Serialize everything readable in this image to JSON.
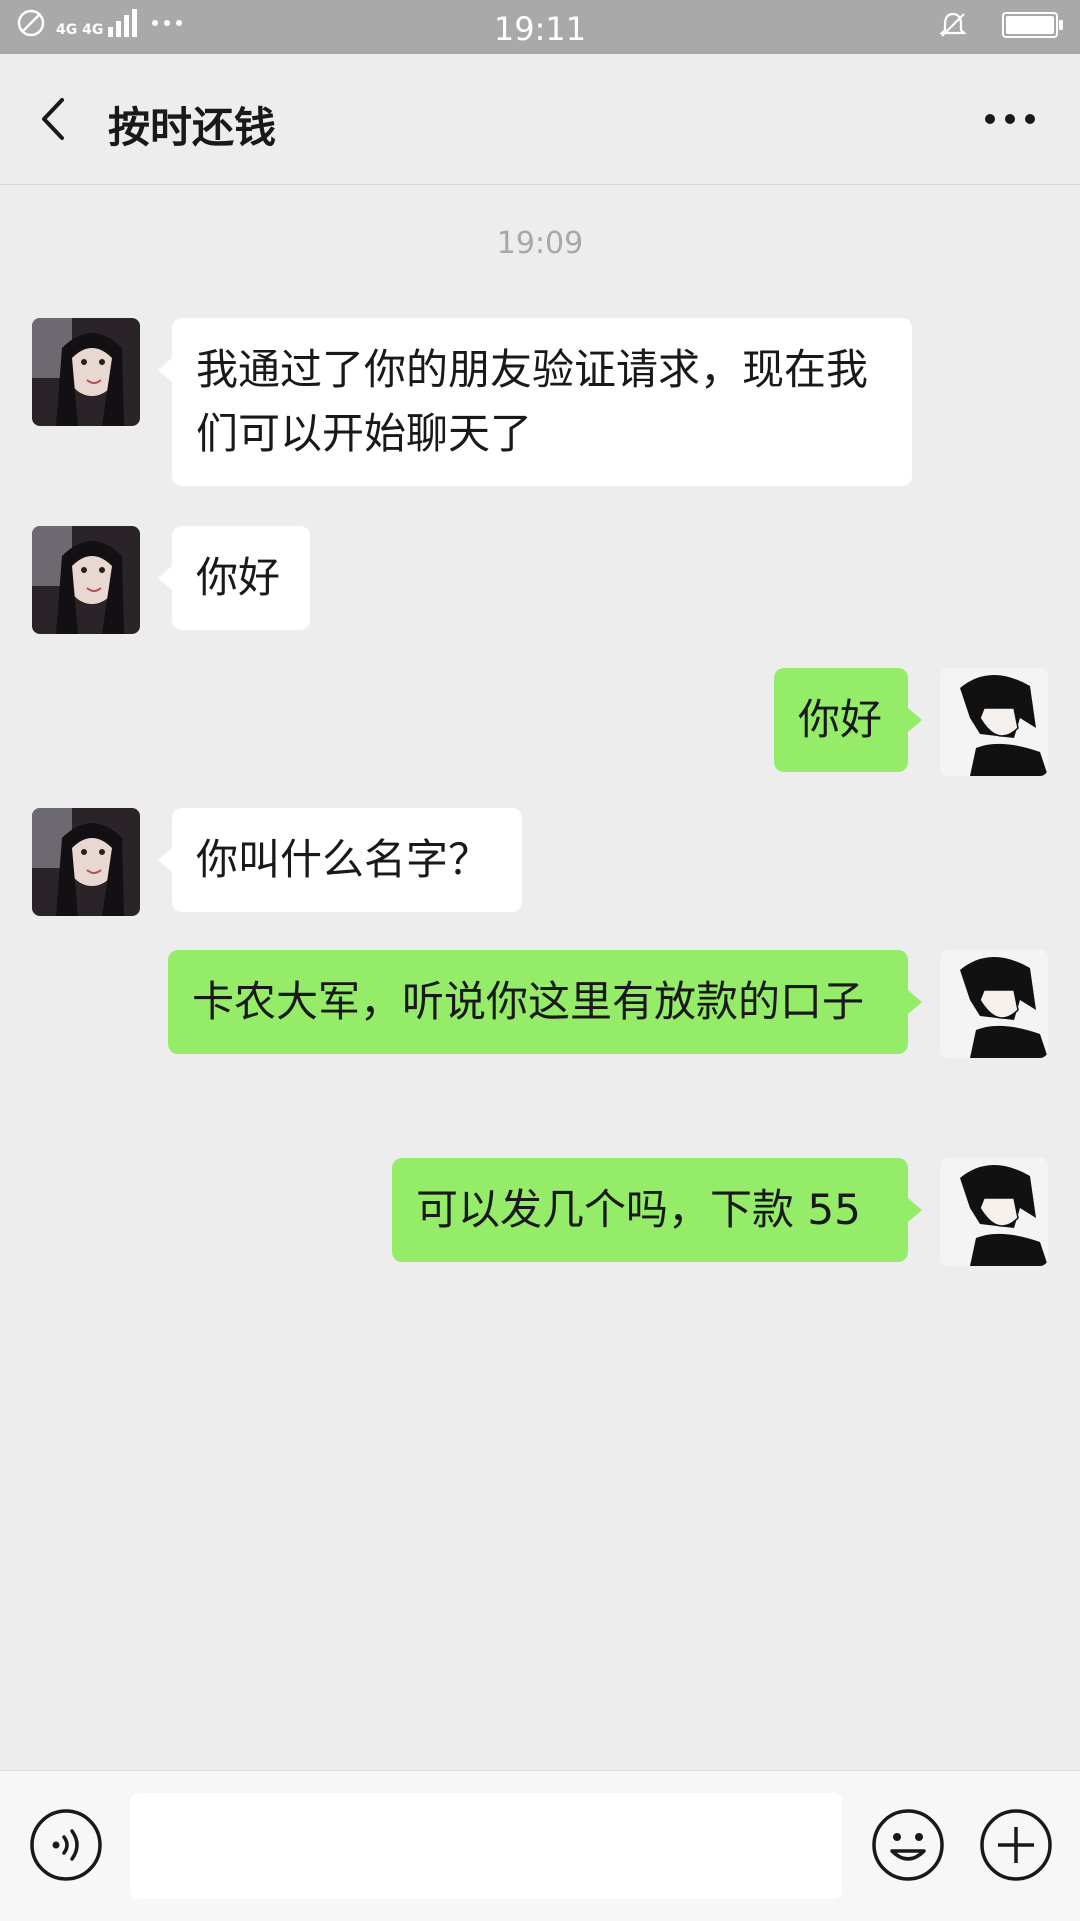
{
  "status_bar": {
    "network": "4G 4G",
    "time": "19:11",
    "battery_level": 1.0
  },
  "header": {
    "title": "按时还钱",
    "back_icon": "chevron-left-icon",
    "more_icon": "more-dots-icon"
  },
  "chat": {
    "timestamp": "19:09",
    "messages": [
      {
        "side": "left",
        "text": "我通过了你的朋友验证请求，现在我们可以开始聊天了"
      },
      {
        "side": "left",
        "text": "你好"
      },
      {
        "side": "right",
        "text": "你好"
      },
      {
        "side": "left",
        "text": "你叫什么名字？"
      },
      {
        "side": "right",
        "text": "卡农大军，听说你这里有放款的口子"
      },
      {
        "side": "right",
        "text": "可以发几个吗，下款 55"
      }
    ]
  },
  "input_bar": {
    "voice_icon": "voice-icon",
    "text_value": "",
    "emoji_icon": "emoji-icon",
    "plus_icon": "plus-icon"
  },
  "colors": {
    "background": "#ededed",
    "bubble_self": "#95ec69",
    "bubble_other": "#ffffff",
    "status_bar": "#a9a9a9"
  }
}
